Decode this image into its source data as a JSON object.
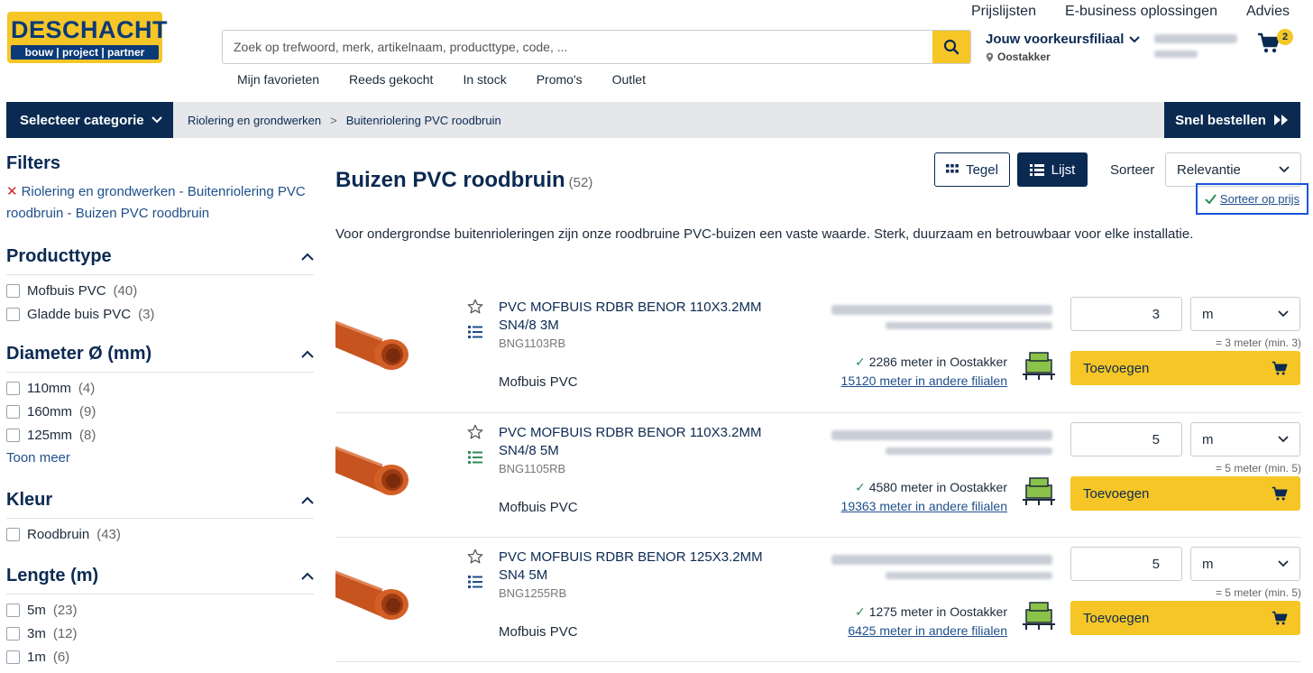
{
  "brand": {
    "name": "DESCHACHT",
    "tagline": "bouw | project | partner"
  },
  "search": {
    "placeholder": "Zoek op trefwoord, merk, artikelnaam, producttype, code, ..."
  },
  "top_links": [
    "Prijslijsten",
    "E-business oplossingen",
    "Advies"
  ],
  "sub_nav": [
    "Mijn favorieten",
    "Reeds gekocht",
    "In stock",
    "Promo's",
    "Outlet"
  ],
  "store": {
    "title": "Jouw voorkeursfiliaal",
    "location": "Oostakker"
  },
  "cart": {
    "count": "2"
  },
  "category_bar": {
    "select_label": "Selecteer categorie",
    "breadcrumb": [
      "Riolering en grondwerken",
      "Buitenriolering PVC roodbruin"
    ],
    "breadcrumb_sep": ">",
    "quick_order": "Snel bestellen"
  },
  "filters": {
    "title": "Filters",
    "active": "Riolering en grondwerken - Buitenriolering PVC roodbruin - Buizen PVC roodbruin",
    "groups": [
      {
        "title": "Producttype",
        "options": [
          {
            "label": "Mofbuis PVC",
            "count": "(40)"
          },
          {
            "label": "Gladde buis PVC",
            "count": "(3)"
          }
        ]
      },
      {
        "title": "Diameter Ø (mm)",
        "options": [
          {
            "label": "110mm",
            "count": "(4)"
          },
          {
            "label": "160mm",
            "count": "(9)"
          },
          {
            "label": "125mm",
            "count": "(8)"
          }
        ],
        "more": "Toon meer"
      },
      {
        "title": "Kleur",
        "options": [
          {
            "label": "Roodbruin",
            "count": "(43)"
          }
        ]
      },
      {
        "title": "Lengte (m)",
        "options": [
          {
            "label": "5m",
            "count": "(23)"
          },
          {
            "label": "3m",
            "count": "(12)"
          },
          {
            "label": "1m",
            "count": "(6)"
          }
        ]
      }
    ]
  },
  "listing": {
    "title": "Buizen PVC roodbruin",
    "count": "(52)",
    "view_tegel": "Tegel",
    "view_lijst": "Lijst",
    "sort_label": "Sorteer",
    "sort_value": "Relevantie",
    "sort_price": "Sorteer op prijs",
    "intro": "Voor ondergrondse buitenrioleringen zijn onze roodbruine PVC-buizen een vaste waarde. Sterk, duurzaam en betrouwbaar voor elke installatie."
  },
  "products": [
    {
      "name": "PVC MOFBUIS RDBR BENOR 110X3.2MM SN4/8 3M",
      "sku": "BNG1103RB",
      "type": "Mofbuis PVC",
      "stock_local": "2286 meter in Oostakker",
      "stock_other": "15120 meter in andere filialen",
      "qty": "3",
      "unit": "m",
      "min": "= 3 meter (min. 3)",
      "add": "Toevoegen"
    },
    {
      "name": "PVC MOFBUIS RDBR BENOR 110X3.2MM SN4/8 5M",
      "sku": "BNG1105RB",
      "type": "Mofbuis PVC",
      "stock_local": "4580 meter in Oostakker",
      "stock_other": "19363 meter in andere filialen",
      "qty": "5",
      "unit": "m",
      "min": "= 5 meter (min. 5)",
      "add": "Toevoegen"
    },
    {
      "name": "PVC MOFBUIS RDBR BENOR 125X3.2MM SN4 5M",
      "sku": "BNG1255RB",
      "type": "Mofbuis PVC",
      "stock_local": "1275 meter in Oostakker",
      "stock_other": "6425 meter in andere filialen",
      "qty": "5",
      "unit": "m",
      "min": "= 5 meter (min. 5)",
      "add": "Toevoegen"
    }
  ],
  "colors": {
    "navy": "#0b2a52",
    "yellow": "#f6c626",
    "link": "#1e4f8a",
    "ok": "#2e8b57",
    "focus": "#1a56db"
  }
}
